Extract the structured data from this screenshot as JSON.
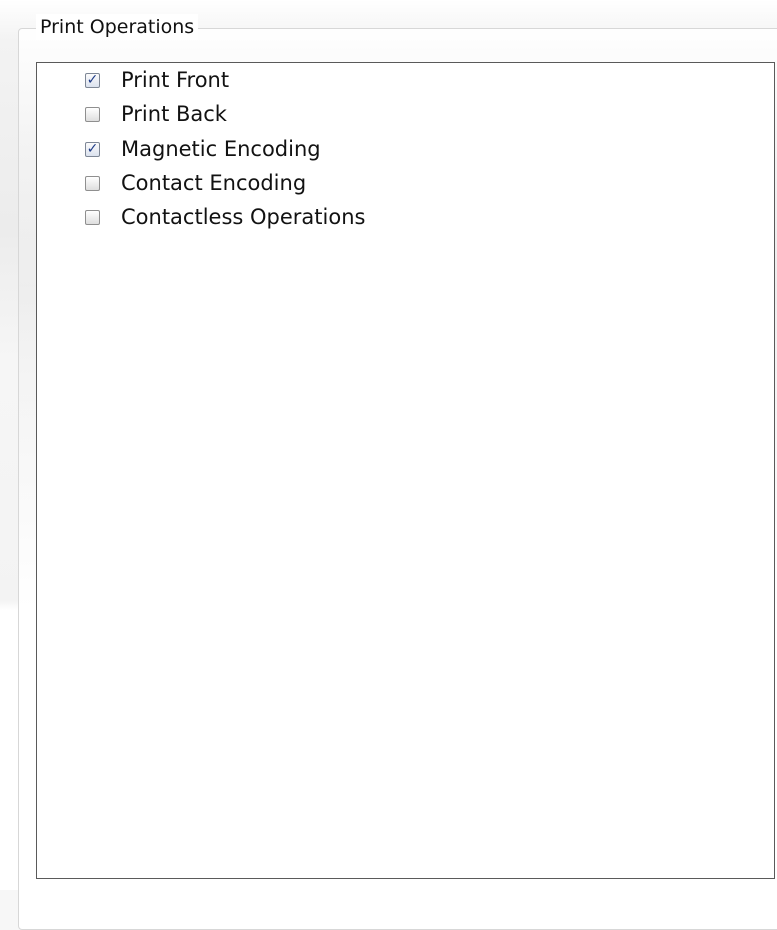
{
  "panel": {
    "title": "Print Operations"
  },
  "options": [
    {
      "label": "Print Front",
      "checked": true
    },
    {
      "label": "Print Back",
      "checked": false
    },
    {
      "label": "Magnetic Encoding",
      "checked": true
    },
    {
      "label": "Contact Encoding",
      "checked": false
    },
    {
      "label": "Contactless Operations",
      "checked": false
    }
  ]
}
